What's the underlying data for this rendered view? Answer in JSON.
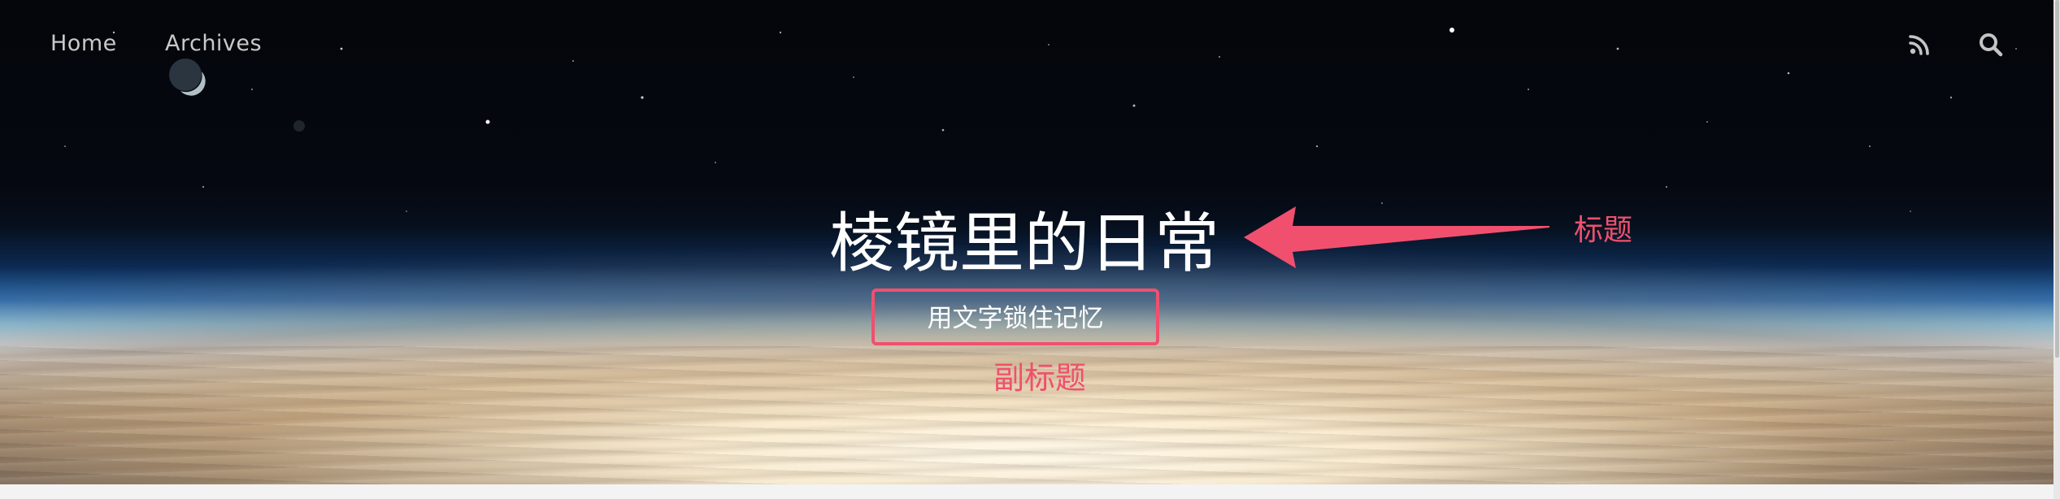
{
  "nav": {
    "links": [
      {
        "label": "Home"
      },
      {
        "label": "Archives"
      }
    ],
    "icons": [
      "rss-icon",
      "search-icon"
    ]
  },
  "hero": {
    "title": "棱镜里的日常",
    "subtitle": "用文字锁住记忆"
  },
  "annotations": {
    "title_label": "标题",
    "subtitle_label": "副标题",
    "color": "#f0506e"
  }
}
